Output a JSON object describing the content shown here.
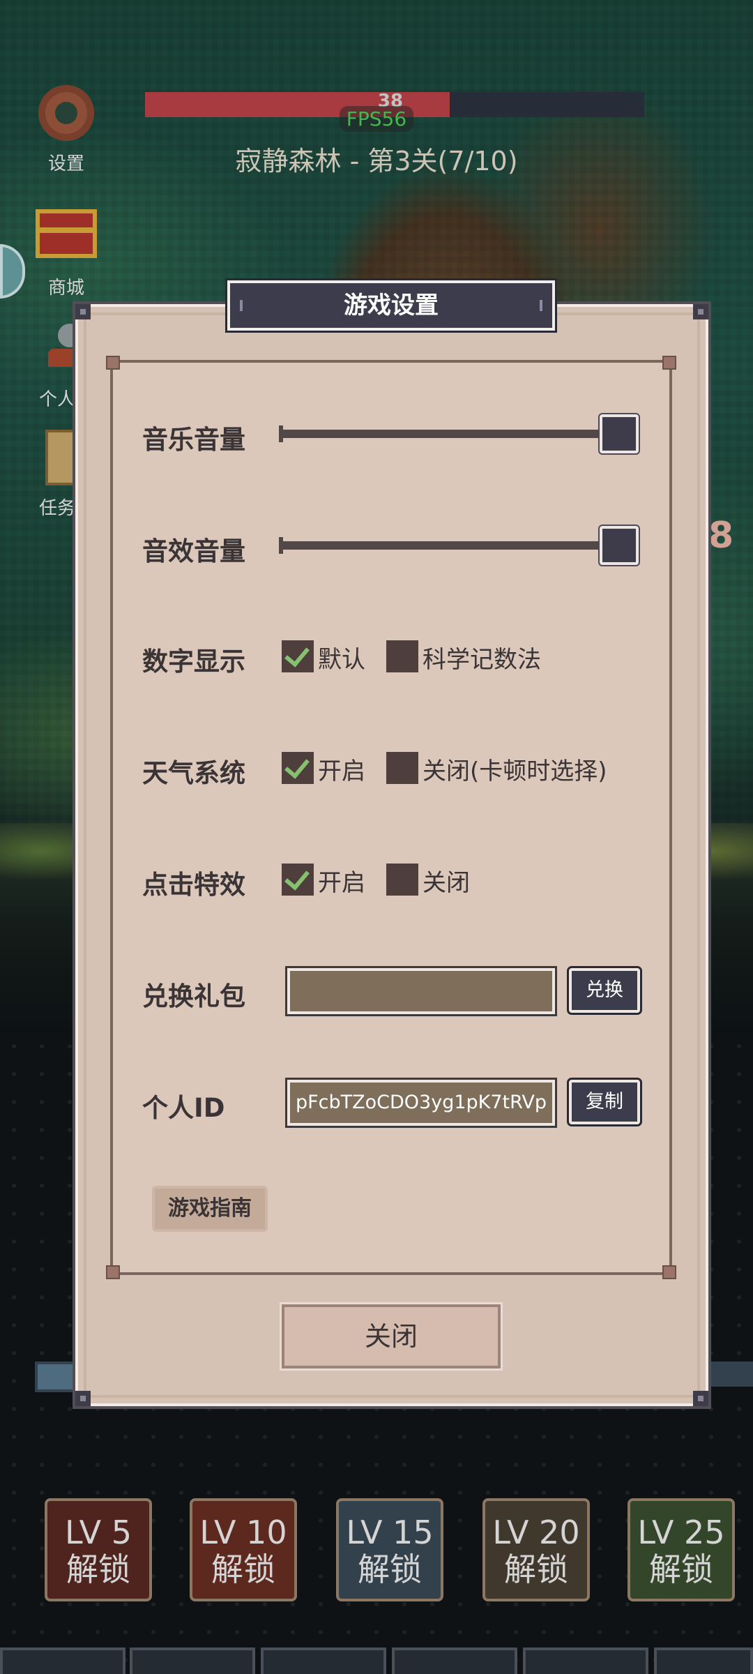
{
  "hud": {
    "hp_value": "38",
    "hp_fraction": 0.61,
    "fps": "FPS56",
    "stage": "寂静森林 - 第3关(7/10)"
  },
  "side_menu": [
    {
      "label": "设置",
      "icon": "gear-icon"
    },
    {
      "label": "商城",
      "icon": "chest-icon"
    },
    {
      "label": "个人信",
      "icon": "person-icon"
    },
    {
      "label": "任务成",
      "icon": "scroll-icon"
    }
  ],
  "right_number": "8",
  "dialog": {
    "title": "游戏设置",
    "music_volume_label": "音乐音量",
    "music_volume": 1.0,
    "sfx_volume_label": "音效音量",
    "sfx_volume": 1.0,
    "number_display": {
      "label": "数字显示",
      "options": [
        {
          "label": "默认",
          "checked": true
        },
        {
          "label": "科学记数法",
          "checked": false
        }
      ]
    },
    "weather": {
      "label": "天气系统",
      "options": [
        {
          "label": "开启",
          "checked": true
        },
        {
          "label": "关闭(卡顿时选择)",
          "checked": false
        }
      ]
    },
    "click_effect": {
      "label": "点击特效",
      "options": [
        {
          "label": "开启",
          "checked": true
        },
        {
          "label": "关闭",
          "checked": false
        }
      ]
    },
    "redeem": {
      "label": "兑换礼包",
      "value": "",
      "button": "兑换"
    },
    "personal_id": {
      "label": "个人ID",
      "value": "pFcbTZoCDO3yg1pK7tRVp",
      "button": "复制"
    },
    "guide_button": "游戏指南",
    "close_button": "关闭"
  },
  "unlock_slots": [
    {
      "level": "LV 5",
      "label": "解锁",
      "color": "#5a2a24"
    },
    {
      "level": "LV 10",
      "label": "解锁",
      "color": "#6a2e22"
    },
    {
      "level": "LV 15",
      "label": "解锁",
      "color": "#3a4a56"
    },
    {
      "level": "LV 20",
      "label": "解锁",
      "color": "#4a4034"
    },
    {
      "level": "LV 25",
      "label": "解锁",
      "color": "#3c5030"
    }
  ],
  "colors": {
    "hp": "#c04448",
    "fps": "#4fd05a",
    "dialog_bg": "#d5c2b4",
    "button_dark": "#3c3c4c",
    "checkmark": "#86c070"
  }
}
